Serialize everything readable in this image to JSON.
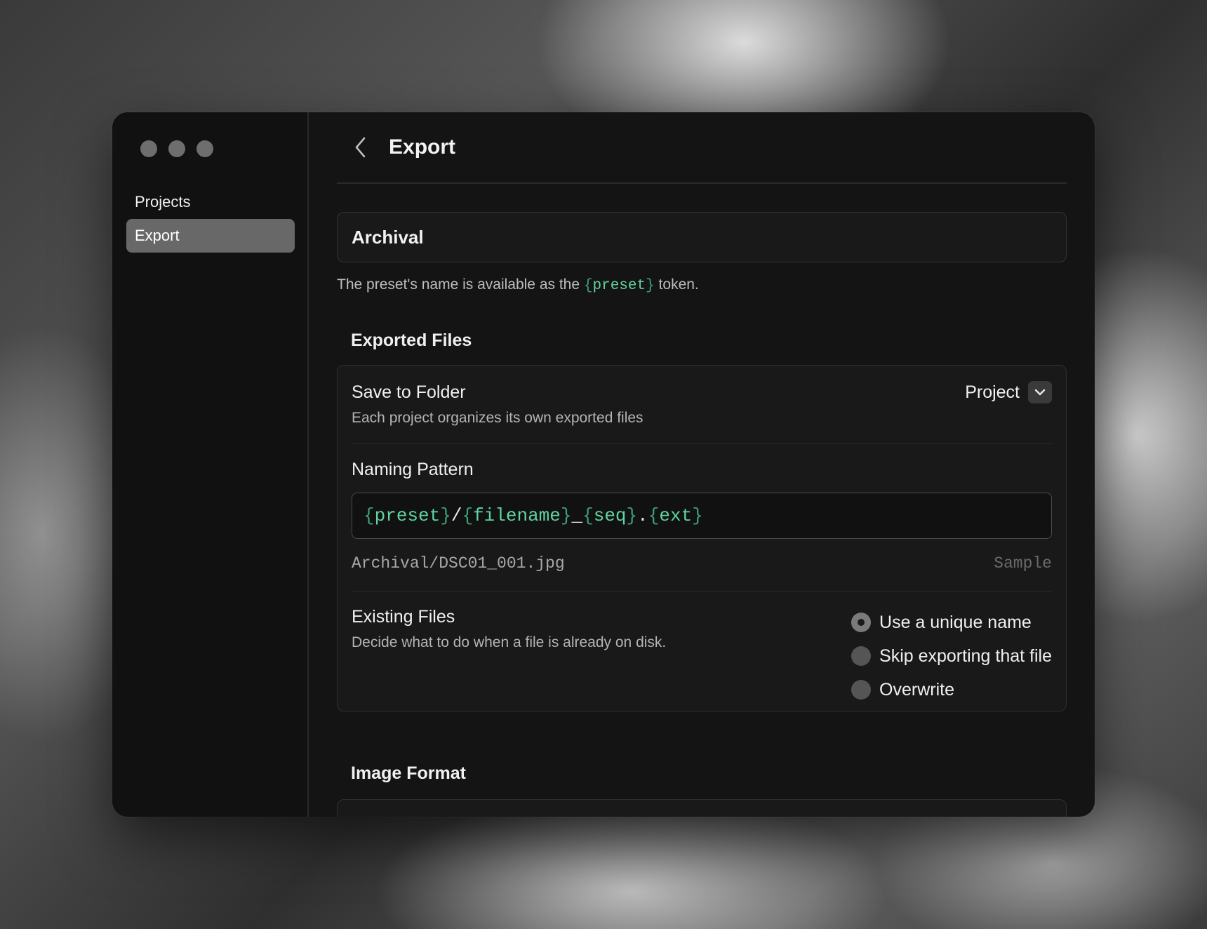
{
  "sidebar": {
    "items": [
      {
        "label": "Projects",
        "active": false
      },
      {
        "label": "Export",
        "active": true
      }
    ]
  },
  "header": {
    "title": "Export",
    "back_icon": "chevron-left-icon"
  },
  "preset": {
    "name": "Archival",
    "hint_prefix": "The preset's name is available as the ",
    "hint_token_open": "{",
    "hint_token": "preset",
    "hint_token_close": "}",
    "hint_suffix": " token."
  },
  "exported_files": {
    "section_title": "Exported Files",
    "save_to_folder": {
      "label": "Save to Folder",
      "description": "Each project organizes its own exported files",
      "selected": "Project"
    },
    "naming_pattern": {
      "label": "Naming Pattern",
      "tokens": [
        {
          "type": "token",
          "text": "preset"
        },
        {
          "type": "literal",
          "text": "/"
        },
        {
          "type": "token",
          "text": "filename"
        },
        {
          "type": "literal",
          "text": "_"
        },
        {
          "type": "token",
          "text": "seq"
        },
        {
          "type": "literal",
          "text": "."
        },
        {
          "type": "token",
          "text": "ext"
        }
      ],
      "sample_path": "Archival/DSC01_001.jpg",
      "sample_label": "Sample"
    },
    "existing_files": {
      "label": "Existing Files",
      "description": "Decide what to do when a file is already on disk.",
      "options": [
        {
          "label": "Use a unique name",
          "selected": true
        },
        {
          "label": "Skip exporting that file",
          "selected": false
        },
        {
          "label": "Overwrite",
          "selected": false
        }
      ]
    }
  },
  "image_format": {
    "section_title": "Image Format"
  },
  "colors": {
    "token_green": "#5fd3a0",
    "window_bg": "#141414",
    "active_nav": "#686868"
  }
}
